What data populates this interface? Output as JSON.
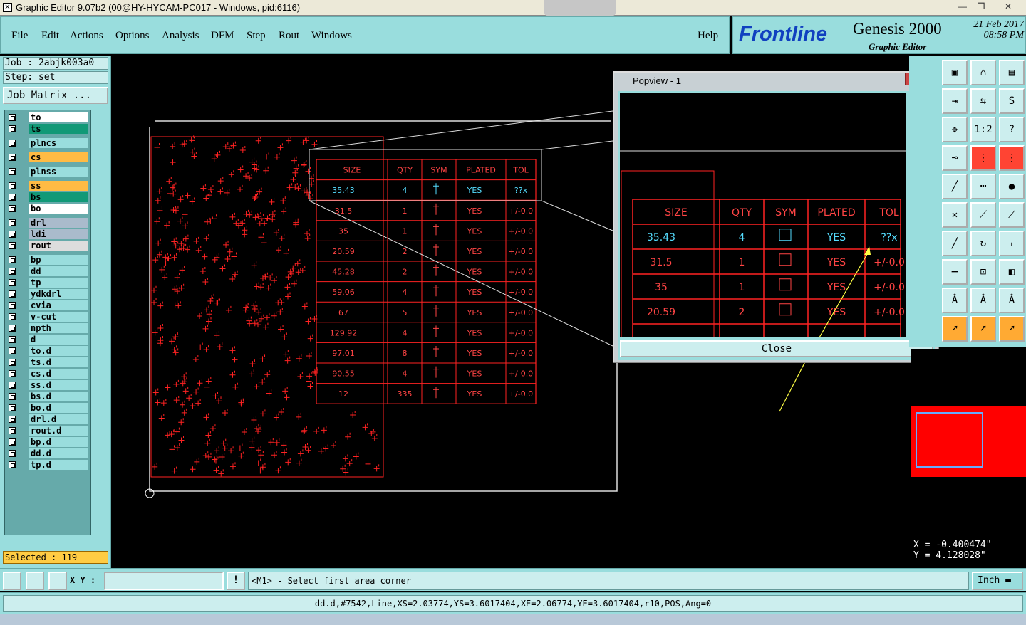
{
  "window": {
    "title": "Graphic Editor 9.07b2 (00@HY-HYCAM-PC017 - Windows, pid:6116)",
    "controls": [
      "—",
      "❐",
      "✕"
    ]
  },
  "menu": {
    "items": [
      "File",
      "Edit",
      "Actions",
      "Options",
      "Analysis",
      "DFM",
      "Step",
      "Rout",
      "Windows"
    ],
    "help": "Help"
  },
  "brand": {
    "logo": "Frontline",
    "product": "Genesis 2000",
    "subtitle": "Graphic Editor",
    "date": "21 Feb 2017",
    "time": "08:58 PM"
  },
  "job": {
    "job_line": "Job : 2abjk003a0",
    "step_line": "Step: set",
    "matrix_button": "Job Matrix ..."
  },
  "layers": [
    {
      "name": "to",
      "color": "#ffffff"
    },
    {
      "name": "ts",
      "color": "#119977"
    },
    {
      "name": "plncs",
      "color": "#99dddd"
    },
    {
      "name": "cs",
      "color": "#ffbb44"
    },
    {
      "name": "plnss",
      "color": "#99dddd"
    },
    {
      "name": "ss",
      "color": "#ffbb44"
    },
    {
      "name": "bs",
      "color": "#119977"
    },
    {
      "name": "bo",
      "color": "#ffffff"
    },
    {
      "name": "drl",
      "color": "#aabbcc"
    },
    {
      "name": "ldi",
      "color": "#aabbcc"
    },
    {
      "name": "rout",
      "color": "#dddddd"
    },
    {
      "name": "bp",
      "color": "#99dddd"
    },
    {
      "name": "dd",
      "color": "#99dddd"
    },
    {
      "name": "tp",
      "color": "#99dddd"
    },
    {
      "name": "ydkdrl",
      "color": "#99dddd"
    },
    {
      "name": "cvia",
      "color": "#99dddd"
    },
    {
      "name": "v-cut",
      "color": "#99dddd"
    },
    {
      "name": "npth",
      "color": "#99dddd"
    },
    {
      "name": "d",
      "color": "#99dddd"
    },
    {
      "name": "to.d",
      "color": "#99dddd"
    },
    {
      "name": "ts.d",
      "color": "#99dddd"
    },
    {
      "name": "cs.d",
      "color": "#99dddd"
    },
    {
      "name": "ss.d",
      "color": "#99dddd"
    },
    {
      "name": "bs.d",
      "color": "#99dddd"
    },
    {
      "name": "bo.d",
      "color": "#99dddd"
    },
    {
      "name": "drl.d",
      "color": "#99dddd"
    },
    {
      "name": "rout.d",
      "color": "#99dddd"
    },
    {
      "name": "bp.d",
      "color": "#99dddd"
    },
    {
      "name": "dd.d",
      "color": "#99dddd"
    },
    {
      "name": "tp.d",
      "color": "#99dddd"
    }
  ],
  "selected": "Selected : 119",
  "drill_table": {
    "headers": [
      "SIZE",
      "QTY",
      "SYM",
      "PLATED",
      "TOL"
    ],
    "rows": [
      {
        "size": "35.43",
        "qty": "4",
        "plated": "YES",
        "tol": "??x"
      },
      {
        "size": "31.5",
        "qty": "1",
        "plated": "YES",
        "tol": "+/-0.0"
      },
      {
        "size": "35",
        "qty": "1",
        "plated": "YES",
        "tol": "+/-0.0"
      },
      {
        "size": "20.59",
        "qty": "2",
        "plated": "YES",
        "tol": "+/-0.0"
      },
      {
        "size": "45.28",
        "qty": "2",
        "plated": "YES",
        "tol": "+/-0.0"
      },
      {
        "size": "59.06",
        "qty": "4",
        "plated": "YES",
        "tol": "+/-0.0"
      },
      {
        "size": "67",
        "qty": "5",
        "plated": "YES",
        "tol": "+/-0.0"
      },
      {
        "size": "129.92",
        "qty": "4",
        "plated": "YES",
        "tol": "+/-0.0"
      },
      {
        "size": "97.01",
        "qty": "8",
        "plated": "YES",
        "tol": "+/-0.0"
      },
      {
        "size": "90.55",
        "qty": "4",
        "plated": "YES",
        "tol": "+/-0.0"
      },
      {
        "size": "12",
        "qty": "335",
        "plated": "YES",
        "tol": "+/-0.0"
      }
    ]
  },
  "popview": {
    "title": "Popview - 1",
    "close_label": "Close"
  },
  "right_tools": [
    "1:2",
    "?"
  ],
  "coords": {
    "x": "X = -0.400474\"",
    "y": "Y = 4.128028\""
  },
  "bottom": {
    "xy_label": "X Y :",
    "xy_value": "",
    "message": "<M1> - Select first area corner",
    "unit": "Inch"
  },
  "status_line": "dd.d,#7542,Line,XS=2.03774,YS=3.6017404,XE=2.06774,YE=3.6017404,r10,POS,Ang=0"
}
